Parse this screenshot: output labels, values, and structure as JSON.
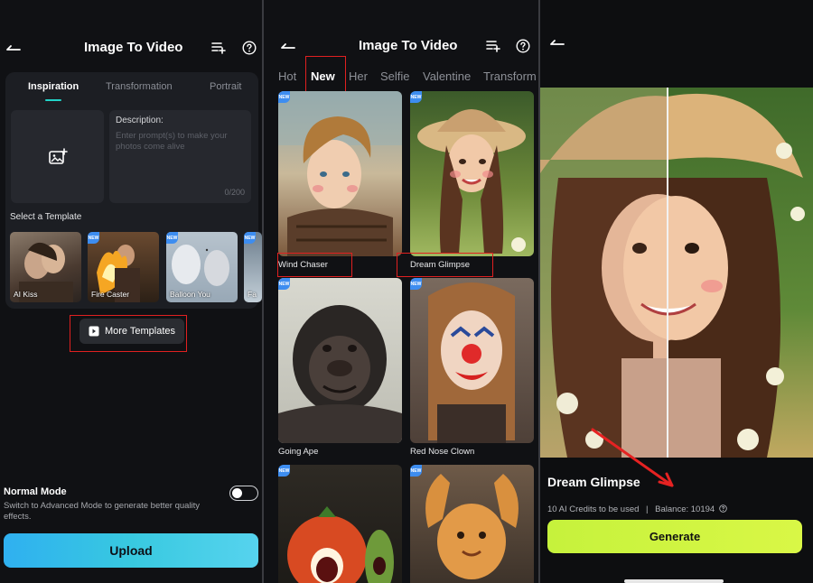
{
  "panel1": {
    "title": "Image To Video",
    "tabs": [
      "Inspiration",
      "Transformation",
      "Portrait"
    ],
    "description_label": "Description:",
    "description_placeholder": "Enter prompt(s) to make your photos come alive",
    "char_count": "0/200",
    "select_template_label": "Select a Template",
    "templates": [
      {
        "label": "AI Kiss"
      },
      {
        "label": "Fire Caster"
      },
      {
        "label": "Balloon You"
      },
      {
        "label": "Fa"
      }
    ],
    "more_templates": "More Templates",
    "mode_title": "Normal Mode",
    "mode_desc": "Switch to Advanced Mode to generate better quality effects.",
    "upload_button": "Upload"
  },
  "panel2": {
    "title": "Image To Video",
    "tabs": [
      "Hot",
      "New",
      "Her",
      "Selfie",
      "Valentine",
      "Transform"
    ],
    "cards": [
      {
        "label": "Wind Chaser"
      },
      {
        "label": "Dream Glimpse"
      },
      {
        "label": "Going Ape"
      },
      {
        "label": "Red Nose Clown"
      }
    ]
  },
  "panel3": {
    "title": "Dream Glimpse",
    "credits": "10 AI Credits to be used",
    "separator": "|",
    "balance": "Balance: 10194",
    "generate_button": "Generate"
  },
  "colors": {
    "accent_teal": "#22d4c8",
    "upload_gradient": "#38c9e0",
    "generate_lime": "#d9f746",
    "highlight_red": "#e02020",
    "new_badge_blue": "#3d8df0"
  },
  "icons": {
    "back": "arrow-left-icon",
    "list": "playlist-icon",
    "help": "question-circle-icon",
    "add_image": "image-plus-icon",
    "video": "video-icon"
  }
}
